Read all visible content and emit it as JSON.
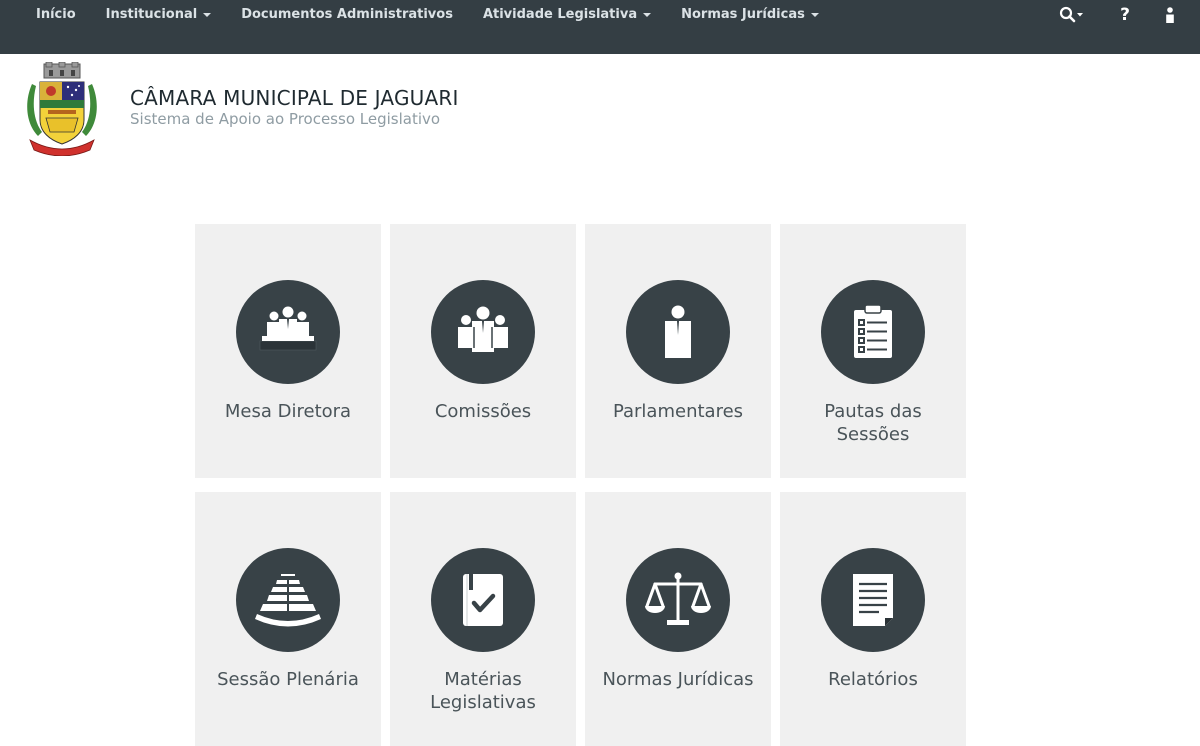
{
  "nav": {
    "items": [
      {
        "label": "Início",
        "dropdown": false
      },
      {
        "label": "Institucional",
        "dropdown": true
      },
      {
        "label": "Documentos Administrativos",
        "dropdown": false
      },
      {
        "label": "Atividade Legislativa",
        "dropdown": true
      },
      {
        "label": "Normas Jurídicas",
        "dropdown": true
      }
    ],
    "right_icons": [
      "search-icon",
      "help-icon",
      "user-icon"
    ],
    "help_glyph": "?"
  },
  "header": {
    "title": "CÂMARA MUNICIPAL DE JAGUARI",
    "subtitle": "Sistema de Apoio ao Processo Legislativo"
  },
  "tiles": [
    {
      "label": "Mesa Diretora",
      "icon": "board-icon"
    },
    {
      "label": "Comissões",
      "icon": "committee-icon"
    },
    {
      "label": "Parlamentares",
      "icon": "parliamentarian-icon"
    },
    {
      "label": "Pautas das Sessões",
      "icon": "agenda-icon"
    },
    {
      "label": "Sessão Plenária",
      "icon": "plenary-icon"
    },
    {
      "label": "Matérias Legislativas",
      "icon": "legislative-matter-icon"
    },
    {
      "label": "Normas Jurídicas",
      "icon": "scales-icon"
    },
    {
      "label": "Relatórios",
      "icon": "report-icon"
    }
  ],
  "colors": {
    "navbar": "#343e44",
    "tile_bg": "#f0f0f0",
    "icon_circle": "#384247"
  }
}
